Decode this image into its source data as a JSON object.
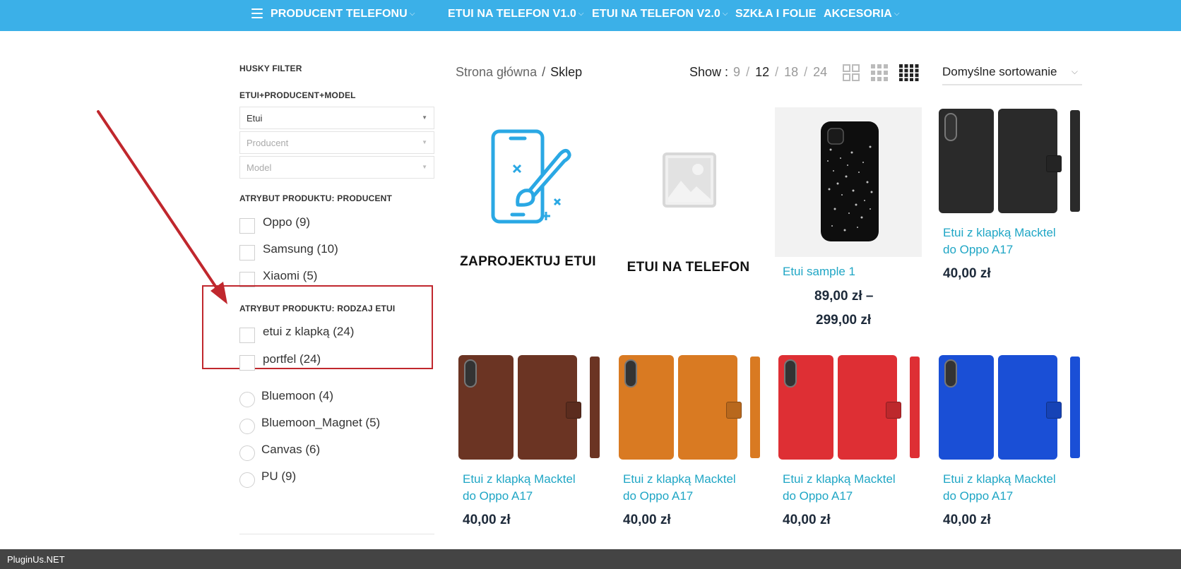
{
  "nav": {
    "producer_label": "PRODUCENT TELEFONU",
    "items": [
      {
        "label": "ETUI NA TELEFON V1.0"
      },
      {
        "label": "ETUI NA TELEFON V2.0"
      },
      {
        "label": "SZKŁA I FOLIE"
      },
      {
        "label": "AKCESORIA"
      }
    ],
    "caret": "⌵"
  },
  "sidebar": {
    "husky_title": "HUSKY FILTER",
    "chain_title": "ETUI+PRODUCENT+MODEL",
    "selects": [
      {
        "value": "Etui"
      },
      {
        "value": "Producent"
      },
      {
        "value": "Model"
      }
    ],
    "select_arrow": "▼",
    "producent_title": "ATRYBUT PRODUKTU: PRODUCENT",
    "producent_items": [
      {
        "label": "Oppo (9)"
      },
      {
        "label": "Samsung (10)"
      },
      {
        "label": "Xiaomi (5)"
      }
    ],
    "rodzaj_title": "ATRYBUT PRODUKTU: RODZAJ ETUI",
    "rodzaj_items": [
      {
        "label": "etui z klapką (24)"
      },
      {
        "label": "portfel (24)"
      }
    ],
    "material_items": [
      {
        "label": "Bluemoon (4)"
      },
      {
        "label": "Bluemoon_Magnet (5)"
      },
      {
        "label": "Canvas (6)"
      },
      {
        "label": "PU (9)"
      }
    ]
  },
  "toolbar": {
    "breadcrumb_home": "Strona główna",
    "breadcrumb_sep": "/",
    "breadcrumb_current": "Sklep",
    "show_label": "Show :",
    "show_options": [
      "9",
      "12",
      "18",
      "24"
    ],
    "show_active": "12",
    "sort_value": "Domyślne sortowanie",
    "sort_arrow": "⌵"
  },
  "products": {
    "design_title": "ZAPROJEKTUJ ETUI",
    "placeholder_title": "ETUI NA TELEFON",
    "sample_name": "Etui sample 1",
    "sample_price_line1": "89,00 zł –",
    "sample_price_line2": "299,00 zł",
    "wallet_name_line1": "Etui z klapką Macktel",
    "wallet_name_line2": "do Oppo A17",
    "wallet_price": "40,00 zł",
    "wallets": [
      {
        "color": "#2a2a2a"
      },
      {
        "color": "#6b3423"
      },
      {
        "color": "#d97a22"
      },
      {
        "color": "#de2f34"
      },
      {
        "color": "#1a4fd6"
      }
    ]
  },
  "footer": {
    "brand": "PluginUs.NET"
  },
  "colors": {
    "nav_bg": "#3bb0e8",
    "link": "#1fa6c5",
    "annotation": "#c0272d"
  }
}
